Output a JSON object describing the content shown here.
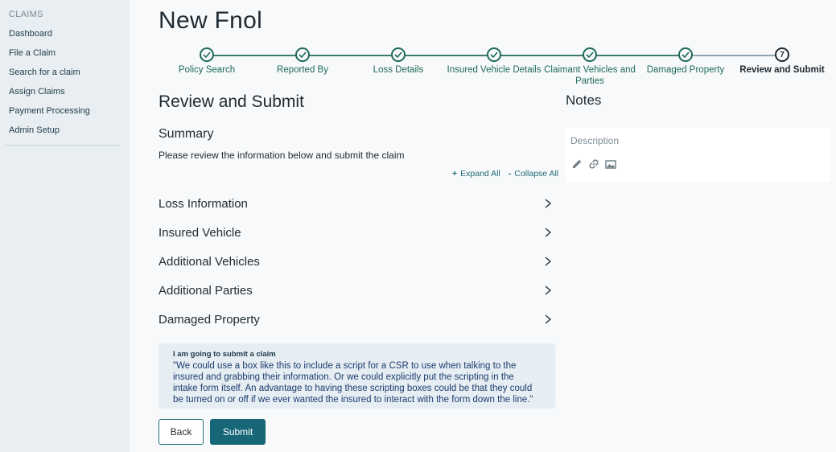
{
  "sidebar": {
    "section_label": "CLAIMS",
    "items": [
      {
        "label": "Dashboard"
      },
      {
        "label": "File a Claim"
      },
      {
        "label": "Search for a claim"
      },
      {
        "label": "Assign Claims"
      },
      {
        "label": "Payment Processing"
      },
      {
        "label": "Admin Setup"
      }
    ]
  },
  "page": {
    "title": "New Fnol"
  },
  "stepper": {
    "steps": [
      {
        "label": "Policy Search",
        "status": "complete"
      },
      {
        "label": "Reported By",
        "status": "complete"
      },
      {
        "label": "Loss Details",
        "status": "complete"
      },
      {
        "label": "Insured Vehicle Details",
        "status": "complete"
      },
      {
        "label": "Claimant Vehicles and Parties",
        "status": "complete"
      },
      {
        "label": "Damaged Property",
        "status": "complete"
      },
      {
        "label": "Review and Submit",
        "status": "current",
        "number": "7"
      }
    ]
  },
  "review": {
    "title": "Review and Submit",
    "summary_title": "Summary",
    "summary_desc": "Please review the information below and submit the claim",
    "expand_all": "Expand All",
    "collapse_all": "Collapse All",
    "expand_symbol": "+",
    "collapse_symbol": "-",
    "sections": [
      {
        "label": "Loss Information"
      },
      {
        "label": "Insured Vehicle"
      },
      {
        "label": "Additional Vehicles"
      },
      {
        "label": "Additional Parties"
      },
      {
        "label": "Damaged Property"
      }
    ]
  },
  "script_box": {
    "title": "I am going to submit a claim",
    "text": "\"We could use a box like this to include a script for a CSR to use when talking to the insured and grabbing their information. Or we could explicitly put the scripting in the intake form itself. An advantage to having these scripting boxes could be that they could be turned on or off if we ever wanted the insured to interact with the form down the line.\""
  },
  "actions": {
    "back_label": "Back",
    "submit_label": "Submit"
  },
  "notes": {
    "title": "Notes",
    "description_placeholder": "Description",
    "tools": [
      "pencil-icon",
      "link-icon",
      "image-icon"
    ]
  },
  "colors": {
    "accent": "#176778",
    "step_complete": "#1f6a55",
    "sidebar_bg": "#e8eef1",
    "script_box_bg": "#e6edf3"
  }
}
